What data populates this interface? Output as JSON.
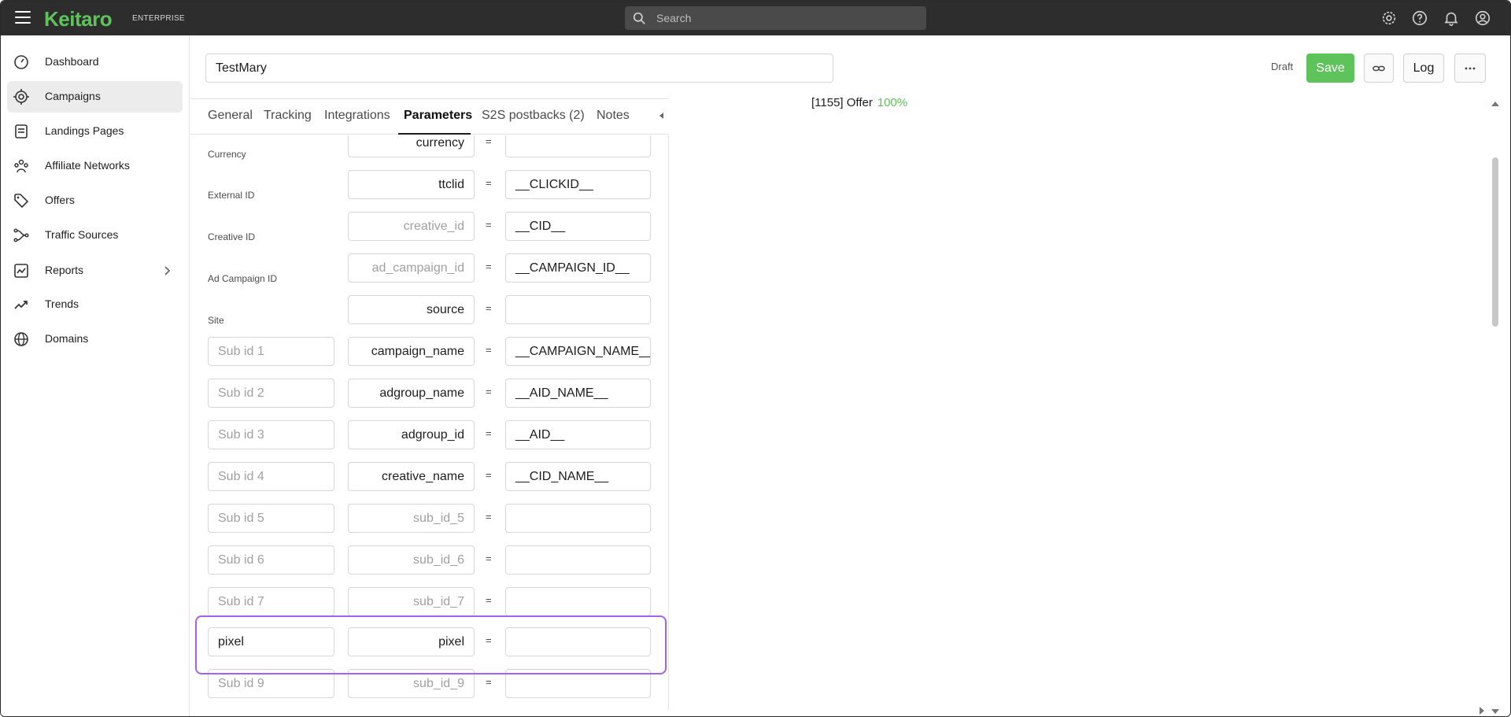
{
  "brand": {
    "logo": "Keitaro",
    "edition": "ENTERPRISE",
    "accent": "#5fc35b"
  },
  "search": {
    "placeholder": "Search"
  },
  "topbar_icons": [
    "gear-icon",
    "help-icon",
    "bell-icon",
    "user-icon"
  ],
  "sidebar": {
    "items": [
      {
        "label": "Dashboard",
        "icon": "gauge-icon"
      },
      {
        "label": "Campaigns",
        "icon": "target-icon",
        "active": true
      },
      {
        "label": "Landings Pages",
        "icon": "document-icon"
      },
      {
        "label": "Affiliate Networks",
        "icon": "network-icon"
      },
      {
        "label": "Offers",
        "icon": "tag-icon"
      },
      {
        "label": "Traffic Sources",
        "icon": "route-icon"
      },
      {
        "label": "Reports",
        "icon": "chart-icon",
        "has_submenu": true
      },
      {
        "label": "Trends",
        "icon": "trend-icon"
      },
      {
        "label": "Domains",
        "icon": "globe-icon"
      }
    ]
  },
  "header": {
    "campaign_name": "TestMary",
    "status": "Draft",
    "save_label": "Save",
    "log_label": "Log",
    "link_icon": "link-icon",
    "more_icon": "more-icon"
  },
  "tabs": [
    {
      "label": "General"
    },
    {
      "label": "Tracking"
    },
    {
      "label": "Integrations"
    },
    {
      "label": "Parameters",
      "active": true
    },
    {
      "label": "S2S postbacks (2)"
    },
    {
      "label": "Notes"
    }
  ],
  "params": {
    "equals": "=",
    "rows": [
      {
        "label": "Currency",
        "key": "currency",
        "key_is_placeholder": false,
        "value": "",
        "value_is_placeholder": false
      },
      {
        "label": "External ID",
        "key": "ttclid",
        "key_is_placeholder": false,
        "value": "__CLICKID__",
        "value_is_placeholder": false
      },
      {
        "label": "Creative ID",
        "key": "creative_id",
        "key_is_placeholder": true,
        "value": "__CID__",
        "value_is_placeholder": false
      },
      {
        "label": "Ad Campaign ID",
        "key": "ad_campaign_id",
        "key_is_placeholder": true,
        "value": "__CAMPAIGN_ID__",
        "value_is_placeholder": false
      },
      {
        "label": "Site",
        "key": "source",
        "key_is_placeholder": false,
        "value": "",
        "value_is_placeholder": false
      },
      {
        "name": "Sub id 1",
        "name_is_placeholder": true,
        "key": "campaign_name",
        "key_is_placeholder": false,
        "value": "__CAMPAIGN_NAME__",
        "value_is_placeholder": false
      },
      {
        "name": "Sub id 2",
        "name_is_placeholder": true,
        "key": "adgroup_name",
        "key_is_placeholder": false,
        "value": "__AID_NAME__",
        "value_is_placeholder": false
      },
      {
        "name": "Sub id 3",
        "name_is_placeholder": true,
        "key": "adgroup_id",
        "key_is_placeholder": false,
        "value": "__AID__",
        "value_is_placeholder": false
      },
      {
        "name": "Sub id 4",
        "name_is_placeholder": true,
        "key": "creative_name",
        "key_is_placeholder": false,
        "value": "__CID_NAME__",
        "value_is_placeholder": false
      },
      {
        "name": "Sub id 5",
        "name_is_placeholder": true,
        "key": "sub_id_5",
        "key_is_placeholder": true,
        "value": "",
        "value_is_placeholder": false
      },
      {
        "name": "Sub id 6",
        "name_is_placeholder": true,
        "key": "sub_id_6",
        "key_is_placeholder": true,
        "value": "",
        "value_is_placeholder": false
      },
      {
        "name": "Sub id 7",
        "name_is_placeholder": true,
        "key": "sub_id_7",
        "key_is_placeholder": true,
        "value": "",
        "value_is_placeholder": false
      },
      {
        "name": "pixel",
        "name_is_placeholder": false,
        "key": "pixel",
        "key_is_placeholder": false,
        "value": "",
        "value_is_placeholder": false,
        "highlighted": true
      },
      {
        "name": "Sub id 9",
        "name_is_placeholder": true,
        "key": "sub_id_9",
        "key_is_placeholder": true,
        "value": "",
        "value_is_placeholder": false
      }
    ]
  },
  "preview": {
    "flow_text": "[1155] Offer",
    "flow_percent": "100%"
  }
}
